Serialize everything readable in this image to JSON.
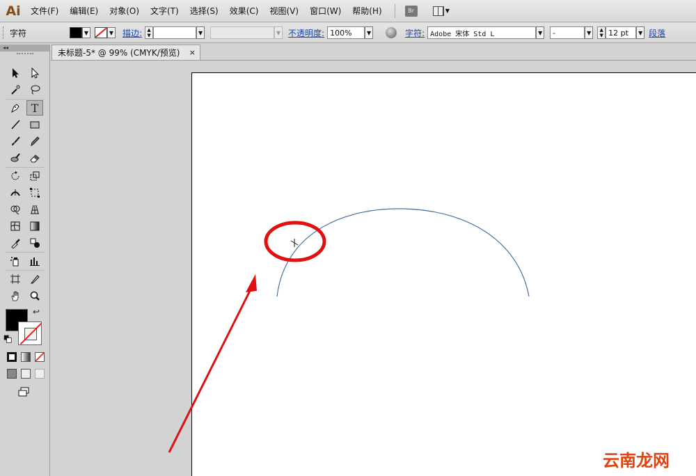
{
  "app": {
    "logo": "Ai"
  },
  "menu": {
    "items": [
      "文件(F)",
      "编辑(E)",
      "对象(O)",
      "文字(T)",
      "选择(S)",
      "效果(C)",
      "视图(V)",
      "窗口(W)",
      "帮助(H)"
    ],
    "bridge_label": "Br"
  },
  "control_bar": {
    "context_label": "字符",
    "stroke_label": "描边:",
    "opacity_label": "不透明度:",
    "opacity_value": "100%",
    "char_label": "字符:",
    "font_family": "Adobe 宋体 Std L",
    "font_style": "-",
    "font_size": "12 pt",
    "paragraph_label": "段落"
  },
  "document": {
    "tab_title": "未标题-5* @ 99% (CMYK/预览)",
    "close_glyph": "×"
  },
  "toolbox": {
    "tools": [
      "selection-tool",
      "direct-selection-tool",
      "magic-wand-tool",
      "lasso-tool",
      "pen-tool",
      "type-tool",
      "line-segment-tool",
      "rectangle-tool",
      "paintbrush-tool",
      "pencil-tool",
      "blob-brush-tool",
      "eraser-tool",
      "rotate-tool",
      "scale-tool",
      "width-tool",
      "free-transform-tool",
      "shape-builder-tool",
      "perspective-grid-tool",
      "mesh-tool",
      "gradient-tool",
      "eyedropper-tool",
      "blend-tool",
      "symbol-sprayer-tool",
      "column-graph-tool",
      "artboard-tool",
      "slice-tool",
      "hand-tool",
      "zoom-tool"
    ],
    "active_tool": "type-tool"
  },
  "colors": {
    "annotation": "#e01010",
    "path_stroke": "#4a6fa5",
    "fill": "#000000"
  },
  "watermark": "云南龙网"
}
